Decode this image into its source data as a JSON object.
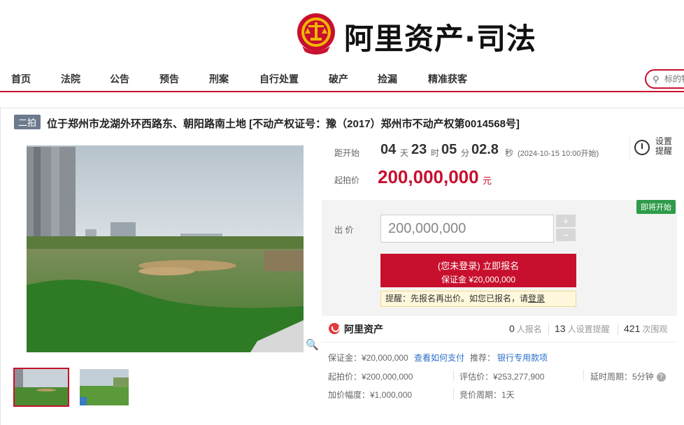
{
  "header": {
    "brand": "阿里资产·司法"
  },
  "nav": {
    "items": [
      "首页",
      "法院",
      "公告",
      "预告",
      "刑案",
      "自行处置",
      "破产",
      "捡漏",
      "精准获客"
    ],
    "search_placeholder": "标的物"
  },
  "lot": {
    "badge": "二拍",
    "title": "位于郑州市龙湖外环西路东、朝阳路南土地 [不动产权证号：豫（2017）郑州市不动产权第0014568号]"
  },
  "countdown": {
    "label": "距开始",
    "days": "04",
    "days_unit": "天",
    "hours": "23",
    "hours_unit": "时",
    "minutes": "05",
    "minutes_unit": "分",
    "seconds": "02.8",
    "seconds_unit": "秒",
    "start_time": "(2024-10-15 10:00开始)"
  },
  "remind": {
    "label": "设置提醒"
  },
  "price": {
    "label": "起拍价",
    "value": "200,000,000",
    "unit": "元"
  },
  "bid": {
    "status_badge": "即将开始",
    "label": "出  价",
    "value": "200,000,000",
    "plus": "+",
    "minus": "−",
    "signup_line1": "(您未登录) 立即报名",
    "signup_line2": "保证金 ¥20,000,000",
    "tip_prefix": "提醒：先报名再出价。如您已报名，请",
    "tip_link": "登录"
  },
  "stats": {
    "brand": "阿里资产",
    "signups": "0",
    "signups_label": "人报名",
    "reminders": "13",
    "reminders_label": "人设置提醒",
    "views": "421",
    "views_label": "次围观"
  },
  "details": {
    "deposit": "保证金：¥20,000,000",
    "how_to_pay": "查看如何支付",
    "recommend_label": "推荐：",
    "bank_loan": "银行专用款项",
    "start_price": "起拍价：¥200,000,000",
    "appraisal": "评估价：¥253,277,900",
    "delay": "延时周期：5分钟",
    "increment": "加价幅度：¥1,000,000",
    "bid_cycle": "竞价周期：1天"
  }
}
